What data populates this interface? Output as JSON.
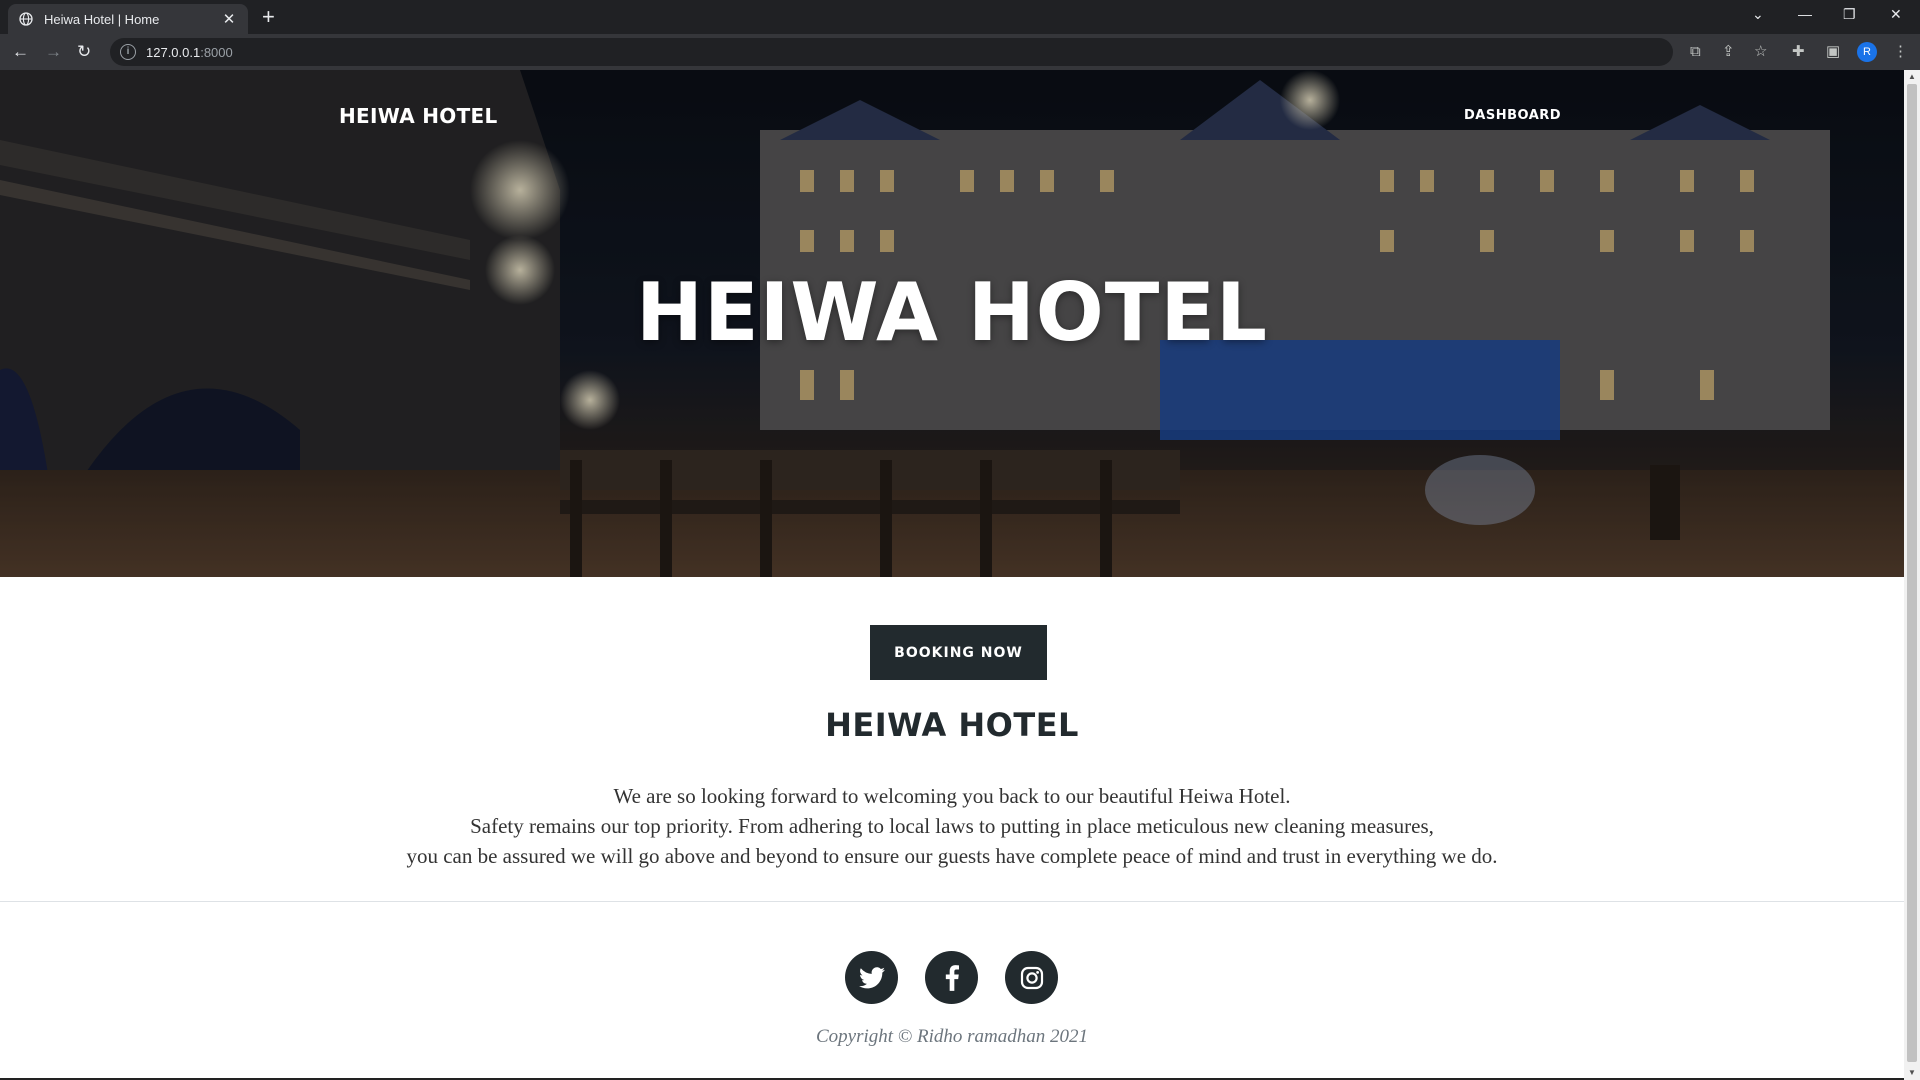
{
  "browser": {
    "tab_title": "Heiwa Hotel | Home",
    "url_host": "127.0.0.1",
    "url_port": ":8000",
    "profile_initial": "R"
  },
  "site": {
    "brand": "HEIWA HOTEL",
    "nav": {
      "dashboard": "DASHBOARD"
    },
    "hero_title": "HEIWA HOTEL",
    "booking_button": "BOOKING NOW",
    "section_title": "HEIWA HOTEL",
    "description": [
      "We are so looking forward to welcoming you back to our beautiful Heiwa Hotel.",
      "Safety remains our top priority. From adhering to local laws to putting in place meticulous new cleaning measures,",
      "you can be assured we will go above and beyond to ensure our guests have complete peace of mind and trust in everything we do."
    ],
    "social": [
      "twitter-icon",
      "facebook-icon",
      "instagram-icon"
    ],
    "copyright": "Copyright © Ridho ramadhan 2021"
  },
  "colors": {
    "chrome_dark": "#202124",
    "chrome_toolbar": "#35363a",
    "button_dark": "#222a2e",
    "text_muted": "#6c757d"
  }
}
